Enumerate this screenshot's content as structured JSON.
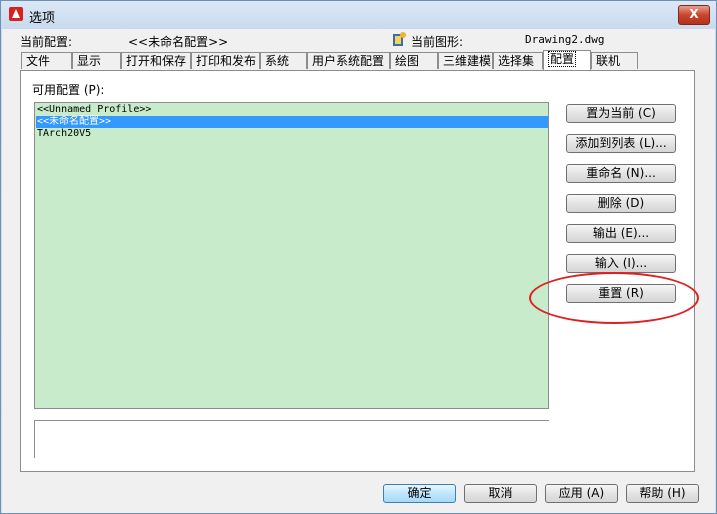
{
  "window": {
    "title": "选项",
    "close_label": "X"
  },
  "header": {
    "current_profile_label": "当前配置:",
    "current_profile_value": "<<未命名配置>>",
    "current_drawing_label": "当前图形:",
    "current_drawing_value": "Drawing2.dwg"
  },
  "tabs": [
    "文件",
    "显示",
    "打开和保存",
    "打印和发布",
    "系统",
    "用户系统配置",
    "绘图",
    "三维建模",
    "选择集",
    "配置",
    "联机"
  ],
  "active_tab": "配置",
  "profiles": {
    "label": "可用配置 (P):",
    "items": [
      "<<Unnamed Profile>>",
      "<<未命名配置>>",
      "TArch20V5"
    ],
    "selected": "<<未命名配置>>"
  },
  "actions": {
    "set_current": "置为当前 (C)",
    "add_to_list": "添加到列表 (L)...",
    "rename": "重命名 (N)...",
    "delete": "删除 (D)",
    "export": "输出 (E)...",
    "import": "输入 (I)...",
    "reset": "重置 (R)"
  },
  "footer": {
    "ok": "确定",
    "cancel": "取消",
    "apply": "应用 (A)",
    "help": "帮助 (H)"
  },
  "colors": {
    "list_bg": "#c7ebcb",
    "selection": "#3399ff",
    "annotation": "#e02020"
  }
}
